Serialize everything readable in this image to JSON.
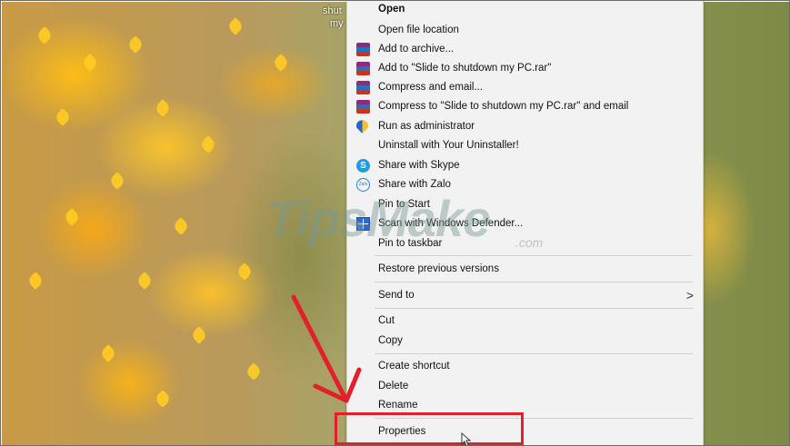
{
  "desktop": {
    "icon_label_line1": "shut",
    "icon_label_line2": "my"
  },
  "context_menu": {
    "items": [
      {
        "label": "Open",
        "icon": null
      },
      {
        "label": "Open file location",
        "icon": null
      },
      {
        "label": "Add to archive...",
        "icon": "winrar-icon"
      },
      {
        "label": "Add to \"Slide to shutdown my PC.rar\"",
        "icon": "winrar-icon"
      },
      {
        "label": "Compress and email...",
        "icon": "winrar-icon"
      },
      {
        "label": "Compress to \"Slide to shutdown my PC.rar\" and email",
        "icon": "winrar-icon"
      },
      {
        "label": "Run as administrator",
        "icon": "uac-shield-icon"
      },
      {
        "label": "Uninstall with Your Uninstaller!",
        "icon": null
      },
      {
        "label": "Share with Skype",
        "icon": "skype-icon"
      },
      {
        "label": "Share with Zalo",
        "icon": "zalo-icon"
      },
      {
        "label": "Pin to Start",
        "icon": null
      },
      {
        "label": "Scan with Windows Defender...",
        "icon": "windows-defender-icon"
      },
      {
        "label": "Pin to taskbar",
        "icon": null
      },
      {
        "label": "Restore previous versions",
        "icon": null
      },
      {
        "label": "Send to",
        "icon": null,
        "submenu": true
      },
      {
        "label": "Cut",
        "icon": null
      },
      {
        "label": "Copy",
        "icon": null
      },
      {
        "label": "Create shortcut",
        "icon": null
      },
      {
        "label": "Delete",
        "icon": null
      },
      {
        "label": "Rename",
        "icon": null
      },
      {
        "label": "Properties",
        "icon": null
      }
    ],
    "submenu_chevron": ">"
  },
  "watermark": {
    "text": "TipsMake",
    "suffix": ".com"
  },
  "annotation": {
    "highlight_color": "#e3202a",
    "arrow_color": "#e3202a"
  }
}
